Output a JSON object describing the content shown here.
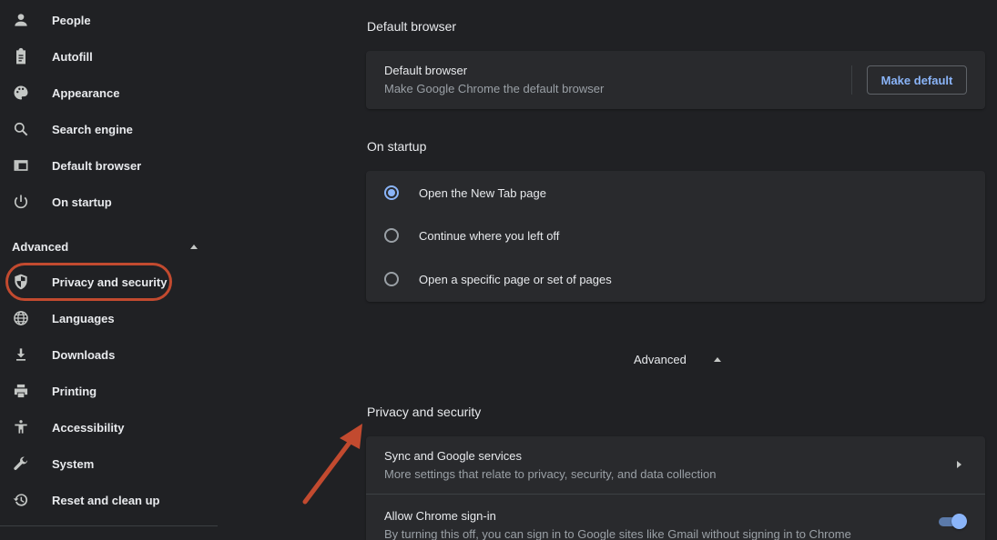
{
  "sidebar": {
    "items": [
      {
        "label": "People",
        "icon": "person-icon"
      },
      {
        "label": "Autofill",
        "icon": "clipboard-icon"
      },
      {
        "label": "Appearance",
        "icon": "palette-icon"
      },
      {
        "label": "Search engine",
        "icon": "search-icon"
      },
      {
        "label": "Default browser",
        "icon": "browser-icon"
      },
      {
        "label": "On startup",
        "icon": "power-icon"
      }
    ],
    "advanced_label": "Advanced",
    "advanced_items": [
      {
        "label": "Privacy and security",
        "icon": "shield-icon"
      },
      {
        "label": "Languages",
        "icon": "globe-icon"
      },
      {
        "label": "Downloads",
        "icon": "download-icon"
      },
      {
        "label": "Printing",
        "icon": "printer-icon"
      },
      {
        "label": "Accessibility",
        "icon": "accessibility-icon"
      },
      {
        "label": "System",
        "icon": "wrench-icon"
      },
      {
        "label": "Reset and clean up",
        "icon": "history-icon"
      }
    ]
  },
  "default_browser": {
    "section_title": "Default browser",
    "row_title": "Default browser",
    "row_subtitle": "Make Google Chrome the default browser",
    "button_label": "Make default"
  },
  "startup": {
    "section_title": "On startup",
    "options": [
      {
        "label": "Open the New Tab page",
        "selected": true
      },
      {
        "label": "Continue where you left off",
        "selected": false
      },
      {
        "label": "Open a specific page or set of pages",
        "selected": false
      }
    ]
  },
  "advanced_toggle": {
    "label": "Advanced"
  },
  "privacy": {
    "section_title": "Privacy and security",
    "rows": [
      {
        "title": "Sync and Google services",
        "subtitle": "More settings that relate to privacy, security, and data collection"
      },
      {
        "title": "Allow Chrome sign-in",
        "subtitle": "By turning this off, you can sign in to Google sites like Gmail without signing in to Chrome",
        "toggle_on": true
      }
    ]
  },
  "colors": {
    "background": "#202124",
    "card": "#292a2d",
    "accent": "#8ab4f8",
    "annotation": "#c24a2f"
  }
}
